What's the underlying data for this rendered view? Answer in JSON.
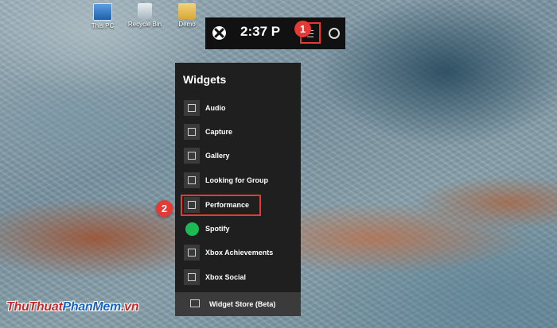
{
  "desktop": {
    "icons": [
      {
        "label": "This PC"
      },
      {
        "label": "Recycle Bin"
      },
      {
        "label": "Demo"
      }
    ]
  },
  "game_bar": {
    "clock": "2:37 P",
    "menu_icon": "list-icon",
    "settings_icon": "gear-icon",
    "logo_icon": "xbox-logo-icon"
  },
  "annotations": {
    "step1": "1",
    "step2": "2",
    "color": "#e53935"
  },
  "widgets_menu": {
    "title": "Widgets",
    "items": [
      {
        "label": "Audio",
        "icon": "speaker-icon"
      },
      {
        "label": "Capture",
        "icon": "capture-icon"
      },
      {
        "label": "Gallery",
        "icon": "gallery-icon"
      },
      {
        "label": "Looking for Group",
        "icon": "binoculars-icon"
      },
      {
        "label": "Performance",
        "icon": "performance-icon",
        "highlighted": true
      },
      {
        "label": "Spotify",
        "icon": "spotify-icon"
      },
      {
        "label": "Xbox Achievements",
        "icon": "trophy-icon"
      },
      {
        "label": "Xbox Social",
        "icon": "people-icon"
      }
    ],
    "store_label": "Widget Store (Beta)",
    "store_icon": "store-icon"
  },
  "watermark": {
    "part1": "ThuThuat",
    "part2": "PhanMem",
    "part3": ".vn"
  }
}
